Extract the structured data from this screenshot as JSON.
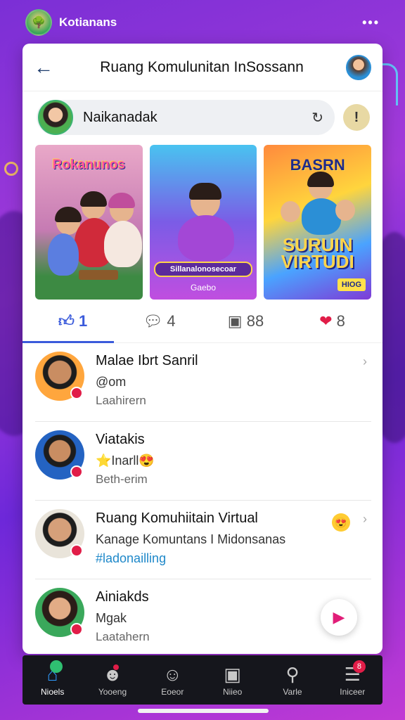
{
  "status": {
    "app_name": "Kotianans",
    "dots": "•••"
  },
  "header": {
    "title": "Ruang Komulunitan InSossann"
  },
  "search": {
    "text": "Naikanadak"
  },
  "thumbs": [
    {
      "caption": "Rokanunos"
    },
    {
      "caption": "Sillanalonosecoar",
      "caption2": "Gaebo"
    },
    {
      "caption": "BASRN",
      "big": "SURUIN VIRTUDI",
      "tag": "HIOG"
    }
  ],
  "reactions": [
    {
      "label": "1",
      "icon": "like"
    },
    {
      "label": "4",
      "icon": "comment"
    },
    {
      "label": "88",
      "icon": "share"
    },
    {
      "label": "8",
      "icon": "heart"
    }
  ],
  "items": [
    {
      "name": "Malae Ibrt Sanril",
      "sub": "@om",
      "time": "Laahirern"
    },
    {
      "name": "Viatakis",
      "sub": "⭐Inarll😍",
      "time": "Beth-erim"
    },
    {
      "name": "Ruang Komuhiitain Virtual",
      "sub": "Kanage Komuntans I Midonsanas",
      "tagline": "#ladonailling"
    },
    {
      "name": "Ainiakds",
      "sub": "Mgak",
      "time": "Laatahern"
    }
  ],
  "nav": [
    {
      "label": "Nioels",
      "icon": "home"
    },
    {
      "label": "Yooeng",
      "icon": "community",
      "badge": ""
    },
    {
      "label": "Eoeor",
      "icon": "smile"
    },
    {
      "label": "Niieo",
      "icon": "bag"
    },
    {
      "label": "Varle",
      "icon": "search"
    },
    {
      "label": "Iniceer",
      "icon": "menu",
      "badge": "8"
    }
  ],
  "colors": {
    "accent": "#3b5bdb",
    "bg": "#8a2be2",
    "badge": "#e11d48"
  }
}
